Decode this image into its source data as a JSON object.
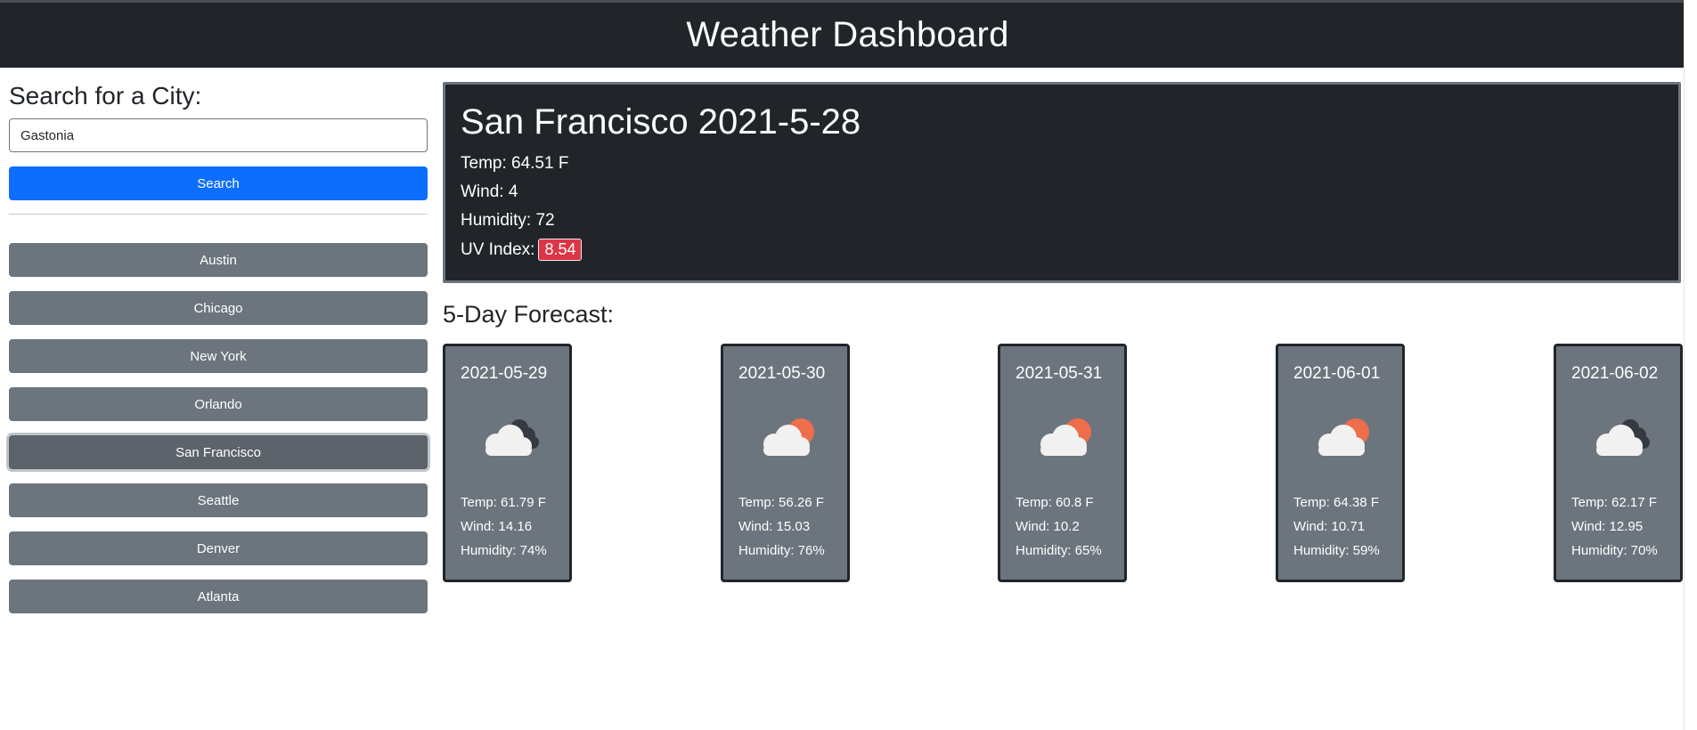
{
  "header": {
    "title": "Weather Dashboard"
  },
  "search": {
    "label": "Search for a City:",
    "value": "Gastonia",
    "button_label": "Search"
  },
  "history": [
    {
      "label": "Austin",
      "active": false
    },
    {
      "label": "Chicago",
      "active": false
    },
    {
      "label": "New York",
      "active": false
    },
    {
      "label": "Orlando",
      "active": false
    },
    {
      "label": "San Francisco",
      "active": true
    },
    {
      "label": "Seattle",
      "active": false
    },
    {
      "label": "Denver",
      "active": false
    },
    {
      "label": "Atlanta",
      "active": false
    }
  ],
  "current": {
    "title": "San Francisco 2021-5-28",
    "temp": "Temp: 64.51 F",
    "wind": "Wind: 4",
    "humidity": "Humidity: 72",
    "uv_label": "UV Index:",
    "uv_value": "8.54",
    "uv_color": "#dc3545"
  },
  "forecast": {
    "title": "5-Day Forecast:",
    "days": [
      {
        "date": "2021-05-29",
        "icon": "cloudy-icon",
        "temp": "Temp: 61.79 F",
        "wind": "Wind: 14.16",
        "humidity": "Humidity: 74%"
      },
      {
        "date": "2021-05-30",
        "icon": "partly-cloudy-icon",
        "temp": "Temp: 56.26 F",
        "wind": "Wind: 15.03",
        "humidity": "Humidity: 76%"
      },
      {
        "date": "2021-05-31",
        "icon": "partly-cloudy-icon",
        "temp": "Temp: 60.8 F",
        "wind": "Wind: 10.2",
        "humidity": "Humidity: 65%"
      },
      {
        "date": "2021-06-01",
        "icon": "partly-cloudy-icon",
        "temp": "Temp: 64.38 F",
        "wind": "Wind: 10.71",
        "humidity": "Humidity: 59%"
      },
      {
        "date": "2021-06-02",
        "icon": "cloudy-icon",
        "temp": "Temp: 62.17 F",
        "wind": "Wind: 12.95",
        "humidity": "Humidity: 70%"
      }
    ]
  },
  "colors": {
    "navbar": "#212529",
    "primary": "#0d6efd",
    "secondary": "#6c757d",
    "uv_danger": "#dc3545",
    "sun": "#ee6e4b"
  }
}
